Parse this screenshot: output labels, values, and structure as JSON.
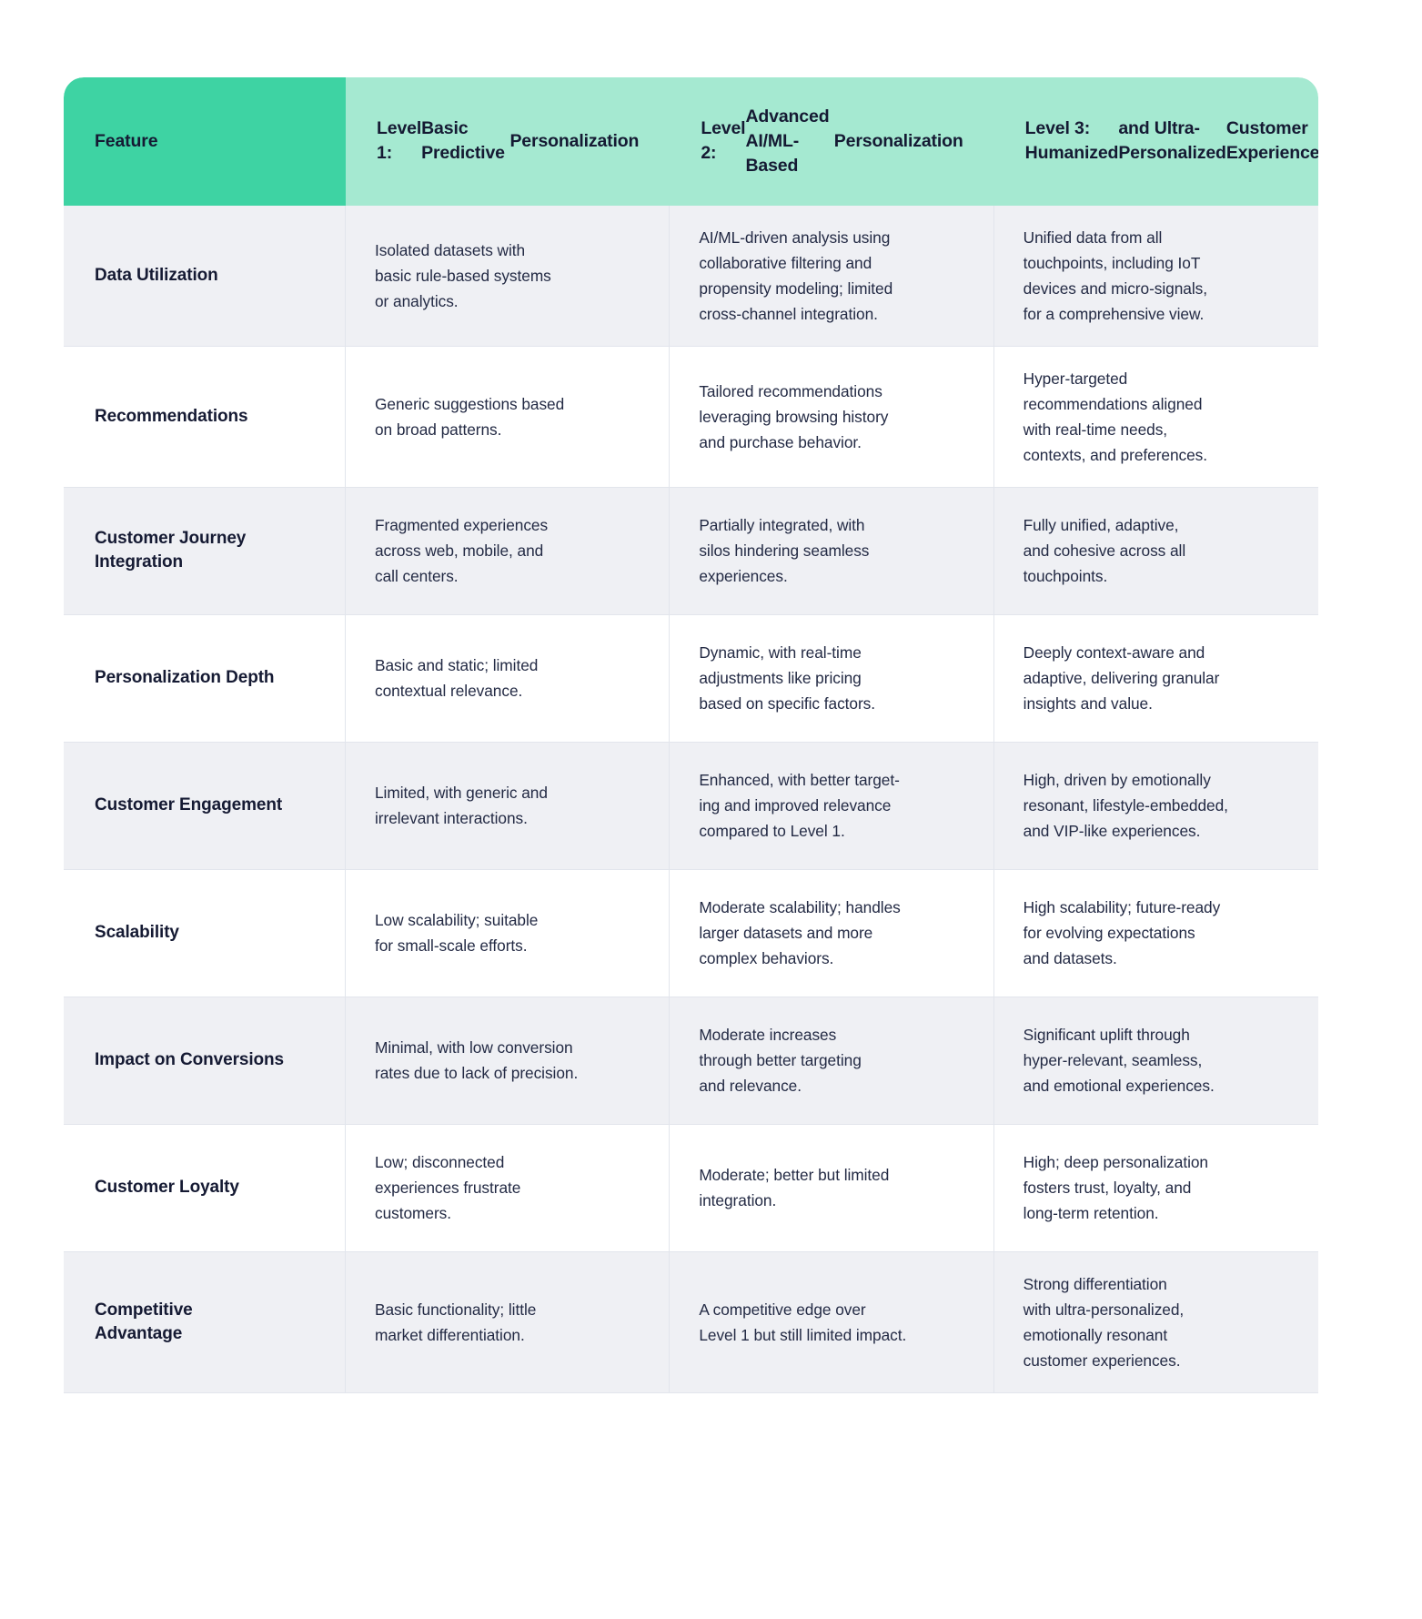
{
  "table": {
    "colors": {
      "header_feature_bg": "#3ed3a3",
      "header_level_bg": "#a5e9d1",
      "row_shade_bg": "#eff0f4",
      "row_plain_bg": "#ffffff",
      "text": "#151a33",
      "border": "#e2e5ec"
    },
    "headers": [
      {
        "lines": [
          "Feature"
        ]
      },
      {
        "lines": [
          "Level 1:",
          "Basic Predictive",
          "Personalization"
        ]
      },
      {
        "lines": [
          "Level 2:",
          "Advanced AI/ML-Based",
          "Personalization"
        ]
      },
      {
        "lines": [
          "Level 3: Humanized",
          "and Ultra-Personalized",
          "Customer Experiences"
        ]
      }
    ],
    "rows": [
      {
        "feature": [
          "Data Utilization"
        ],
        "level1": [
          "Isolated datasets with",
          "basic rule-based systems",
          "or analytics."
        ],
        "level2": [
          "AI/ML-driven analysis using",
          "collaborative filtering and",
          "propensity modeling; limited",
          "cross-channel integration."
        ],
        "level3": [
          "Unified data from all",
          "touchpoints, including IoT",
          "devices and micro-signals,",
          "for a comprehensive view."
        ]
      },
      {
        "feature": [
          "Recommendations"
        ],
        "level1": [
          "Generic suggestions based",
          "on broad patterns."
        ],
        "level2": [
          "Tailored recommendations",
          "leveraging browsing history",
          "and purchase behavior."
        ],
        "level3": [
          "Hyper-targeted",
          "recommendations aligned",
          "with real-time needs,",
          "contexts, and preferences."
        ]
      },
      {
        "feature": [
          "Customer Journey",
          "Integration"
        ],
        "level1": [
          "Fragmented experiences",
          "across web, mobile, and",
          "call centers."
        ],
        "level2": [
          "Partially integrated, with",
          "silos hindering seamless",
          "experiences."
        ],
        "level3": [
          "Fully unified, adaptive,",
          "and cohesive across all",
          "touchpoints."
        ]
      },
      {
        "feature": [
          "Personalization Depth"
        ],
        "level1": [
          "Basic and static; limited",
          "contextual relevance."
        ],
        "level2": [
          "Dynamic, with real-time",
          "adjustments like pricing",
          "based on specific factors."
        ],
        "level3": [
          "Deeply context-aware and",
          "adaptive, delivering granular",
          "insights and value."
        ]
      },
      {
        "feature": [
          "Customer Engagement"
        ],
        "level1": [
          "Limited, with generic and",
          "irrelevant interactions."
        ],
        "level2": [
          "Enhanced, with better target-",
          "ing and improved relevance",
          "compared to Level 1."
        ],
        "level3": [
          "High, driven by emotionally",
          "resonant, lifestyle-embedded,",
          "and VIP-like experiences."
        ]
      },
      {
        "feature": [
          "Scalability"
        ],
        "level1": [
          "Low scalability; suitable",
          "for small-scale efforts."
        ],
        "level2": [
          "Moderate scalability; handles",
          "larger datasets and more",
          "complex behaviors."
        ],
        "level3": [
          "High scalability; future-ready",
          "for evolving expectations",
          "and datasets."
        ]
      },
      {
        "feature": [
          "Impact on Conversions"
        ],
        "level1": [
          "Minimal, with low conversion",
          "rates due to lack of precision."
        ],
        "level2": [
          "Moderate increases",
          "through better targeting",
          "and relevance."
        ],
        "level3": [
          "Significant uplift through",
          "hyper-relevant, seamless,",
          "and emotional experiences."
        ]
      },
      {
        "feature": [
          "Customer Loyalty"
        ],
        "level1": [
          "Low; disconnected",
          "experiences frustrate",
          "customers."
        ],
        "level2": [
          "Moderate; better but limited",
          "integration."
        ],
        "level3": [
          "High; deep personalization",
          "fosters trust, loyalty, and",
          "long-term retention."
        ]
      },
      {
        "feature": [
          "Competitive",
          "Advantage"
        ],
        "level1": [
          "Basic functionality; little",
          "market differentiation."
        ],
        "level2": [
          "A competitive edge over",
          "Level 1 but still limited impact."
        ],
        "level3": [
          "Strong differentiation",
          "with ultra-personalized,",
          "emotionally resonant",
          "customer experiences."
        ]
      }
    ]
  }
}
